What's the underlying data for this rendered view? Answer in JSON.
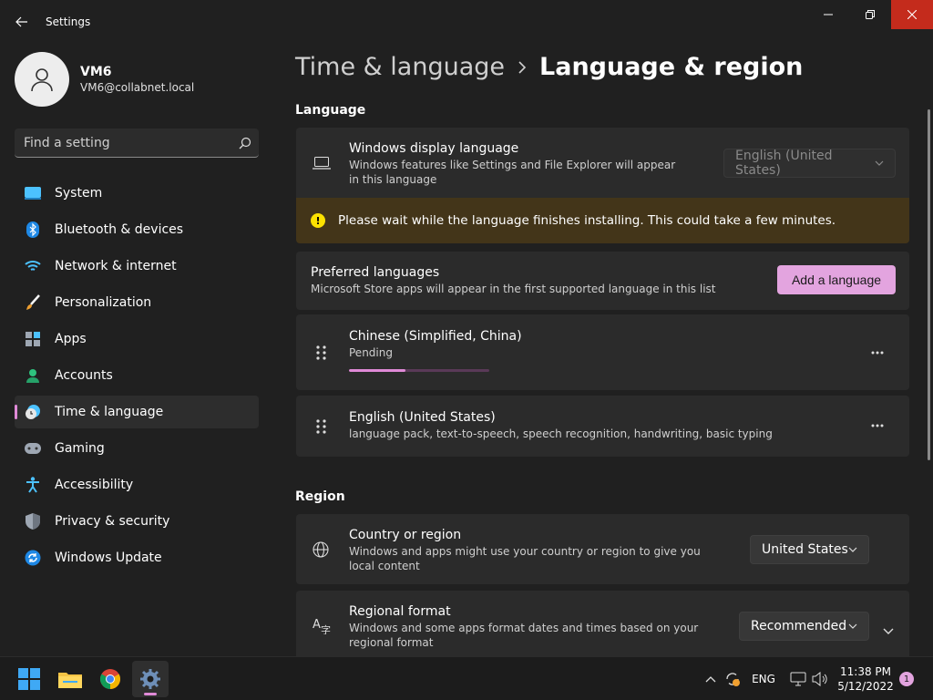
{
  "app": {
    "title": "Settings"
  },
  "profile": {
    "name": "VM6",
    "email": "VM6@collabnet.local"
  },
  "search": {
    "placeholder": "Find a setting"
  },
  "sidebar": {
    "items": [
      {
        "label": "System",
        "icon": "monitor-icon"
      },
      {
        "label": "Bluetooth & devices",
        "icon": "bluetooth-icon"
      },
      {
        "label": "Network & internet",
        "icon": "wifi-icon"
      },
      {
        "label": "Personalization",
        "icon": "brush-icon"
      },
      {
        "label": "Apps",
        "icon": "apps-icon"
      },
      {
        "label": "Accounts",
        "icon": "person-icon"
      },
      {
        "label": "Time & language",
        "icon": "clock-globe-icon",
        "active": true
      },
      {
        "label": "Gaming",
        "icon": "gamepad-icon"
      },
      {
        "label": "Accessibility",
        "icon": "accessibility-icon"
      },
      {
        "label": "Privacy & security",
        "icon": "shield-icon"
      },
      {
        "label": "Windows Update",
        "icon": "sync-icon"
      }
    ]
  },
  "breadcrumb": {
    "parent": "Time & language",
    "current": "Language & region"
  },
  "language_section": {
    "title": "Language",
    "display_language": {
      "title": "Windows display language",
      "description": "Windows features like Settings and File Explorer will appear in this language",
      "value": "English (United States)"
    },
    "warning": "Please wait while the language finishes installing. This could take a few minutes.",
    "preferred": {
      "title": "Preferred languages",
      "description": "Microsoft Store apps will appear in the first supported language in this list",
      "add_button": "Add a language"
    },
    "languages": [
      {
        "name": "Chinese (Simplified, China)",
        "detail": "Pending",
        "progress": 0.4
      },
      {
        "name": "English (United States)",
        "detail": "language pack, text-to-speech, speech recognition, handwriting, basic typing"
      }
    ]
  },
  "region_section": {
    "title": "Region",
    "country": {
      "title": "Country or region",
      "description": "Windows and apps might use your country or region to give you local content",
      "value": "United States"
    },
    "format": {
      "title": "Regional format",
      "description": "Windows and some apps format dates and times based on your regional format",
      "value": "Recommended"
    }
  },
  "taskbar": {
    "input_indicator": "ENG",
    "time": "11:38 PM",
    "date": "5/12/2022",
    "notification_count": "1"
  },
  "colors": {
    "accent": "#e08ad7",
    "button_accent": "#e3a4df",
    "warning_bg": "#433519",
    "close_red": "#c42b1c"
  }
}
